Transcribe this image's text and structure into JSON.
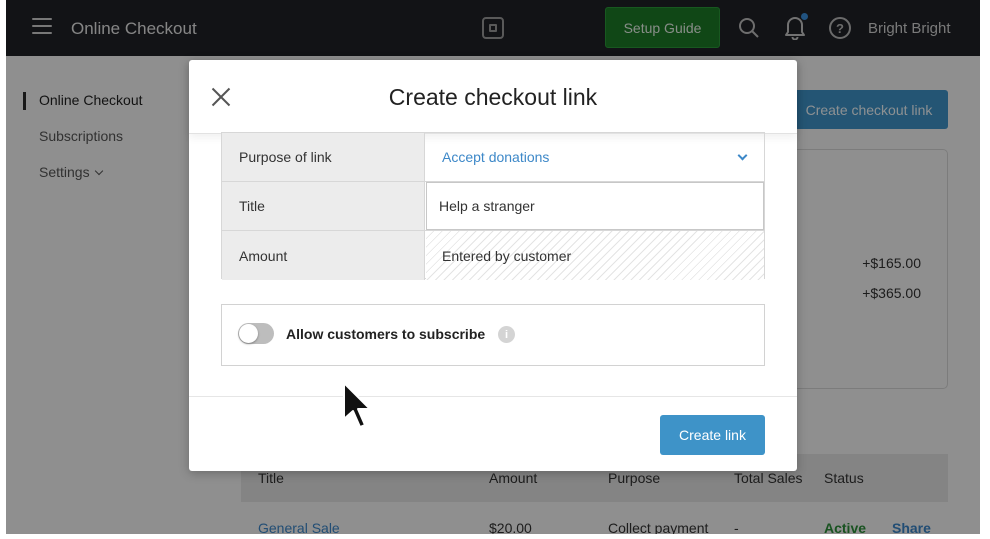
{
  "topbar": {
    "app_title": "Online Checkout",
    "setup_guide_label": "Setup Guide",
    "user_name": "Bright Bright"
  },
  "sidebar": {
    "items": [
      {
        "label": "Online Checkout",
        "active": true
      },
      {
        "label": "Subscriptions",
        "active": false
      },
      {
        "label": "Settings",
        "active": false
      }
    ]
  },
  "main": {
    "create_checkout_link_label": "Create checkout link",
    "summary": {
      "amounts": [
        "+$165.00",
        "+$365.00"
      ]
    },
    "table": {
      "headers": [
        "Title",
        "Amount",
        "Purpose",
        "Total Sales",
        "Status"
      ],
      "rows": [
        {
          "title": "General Sale",
          "amount": "$20.00",
          "purpose": "Collect payment",
          "total_sales": "-",
          "status": "Active",
          "action": "Share"
        }
      ]
    }
  },
  "modal": {
    "title": "Create checkout link",
    "fields": {
      "purpose_label": "Purpose of link",
      "purpose_value": "Accept donations",
      "title_label": "Title",
      "title_value": "Help a stranger",
      "amount_label": "Amount",
      "amount_value": "Entered by customer"
    },
    "subscribe_label": "Allow customers to subscribe",
    "subscribe_enabled": false,
    "create_link_label": "Create link"
  },
  "colors": {
    "accent": "#3e93c8",
    "setup_green": "#1c7a27",
    "topbar": "#1f2226",
    "status_active": "#2c8f3a"
  }
}
